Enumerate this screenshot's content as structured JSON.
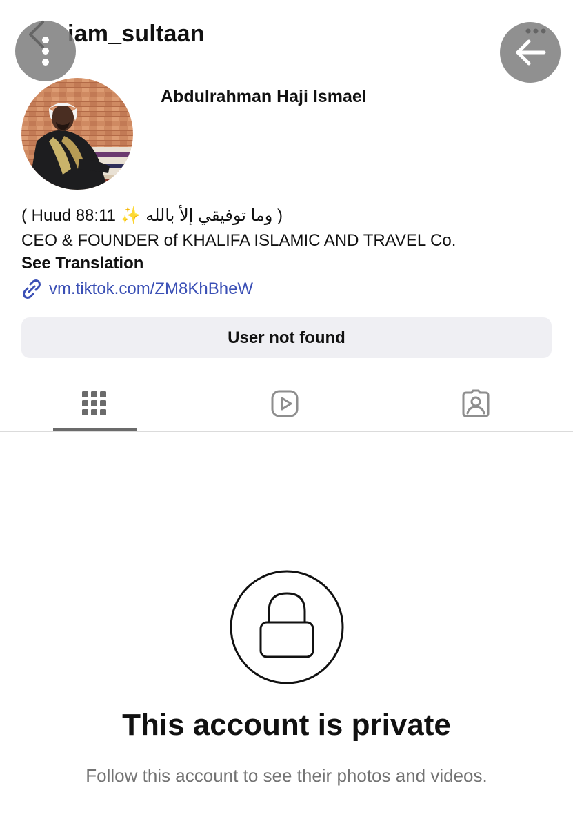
{
  "header": {
    "username": "iam_sultaan",
    "back_icon": "chevron-left-icon",
    "overlay_left_icon": "more-vertical-icon",
    "overlay_right_icon": "arrow-left-icon"
  },
  "profile": {
    "display_name": "Abdulrahman Haji Ismael",
    "bio_line_1": "( Huud 88:11 ✨ وما توفيقي إلأ بالله )",
    "bio_line_2": "CEO & FOUNDER of KHALIFA ISLAMIC AND TRAVEL Co.",
    "see_translation": "See Translation",
    "link": "vm.tiktok.com/ZM8KhBheW"
  },
  "status_button": {
    "label": "User not found"
  },
  "tabs": [
    {
      "icon": "grid-icon",
      "selected": true
    },
    {
      "icon": "reels-icon",
      "selected": false
    },
    {
      "icon": "tagged-icon",
      "selected": false
    }
  ],
  "private_notice": {
    "title": "This account is private",
    "subtitle": "Follow this account to see their photos and videos."
  },
  "colors": {
    "link": "#3a4fb5",
    "button_bg": "#efeff3",
    "subtitle": "#737373",
    "overlay": "#787878"
  }
}
